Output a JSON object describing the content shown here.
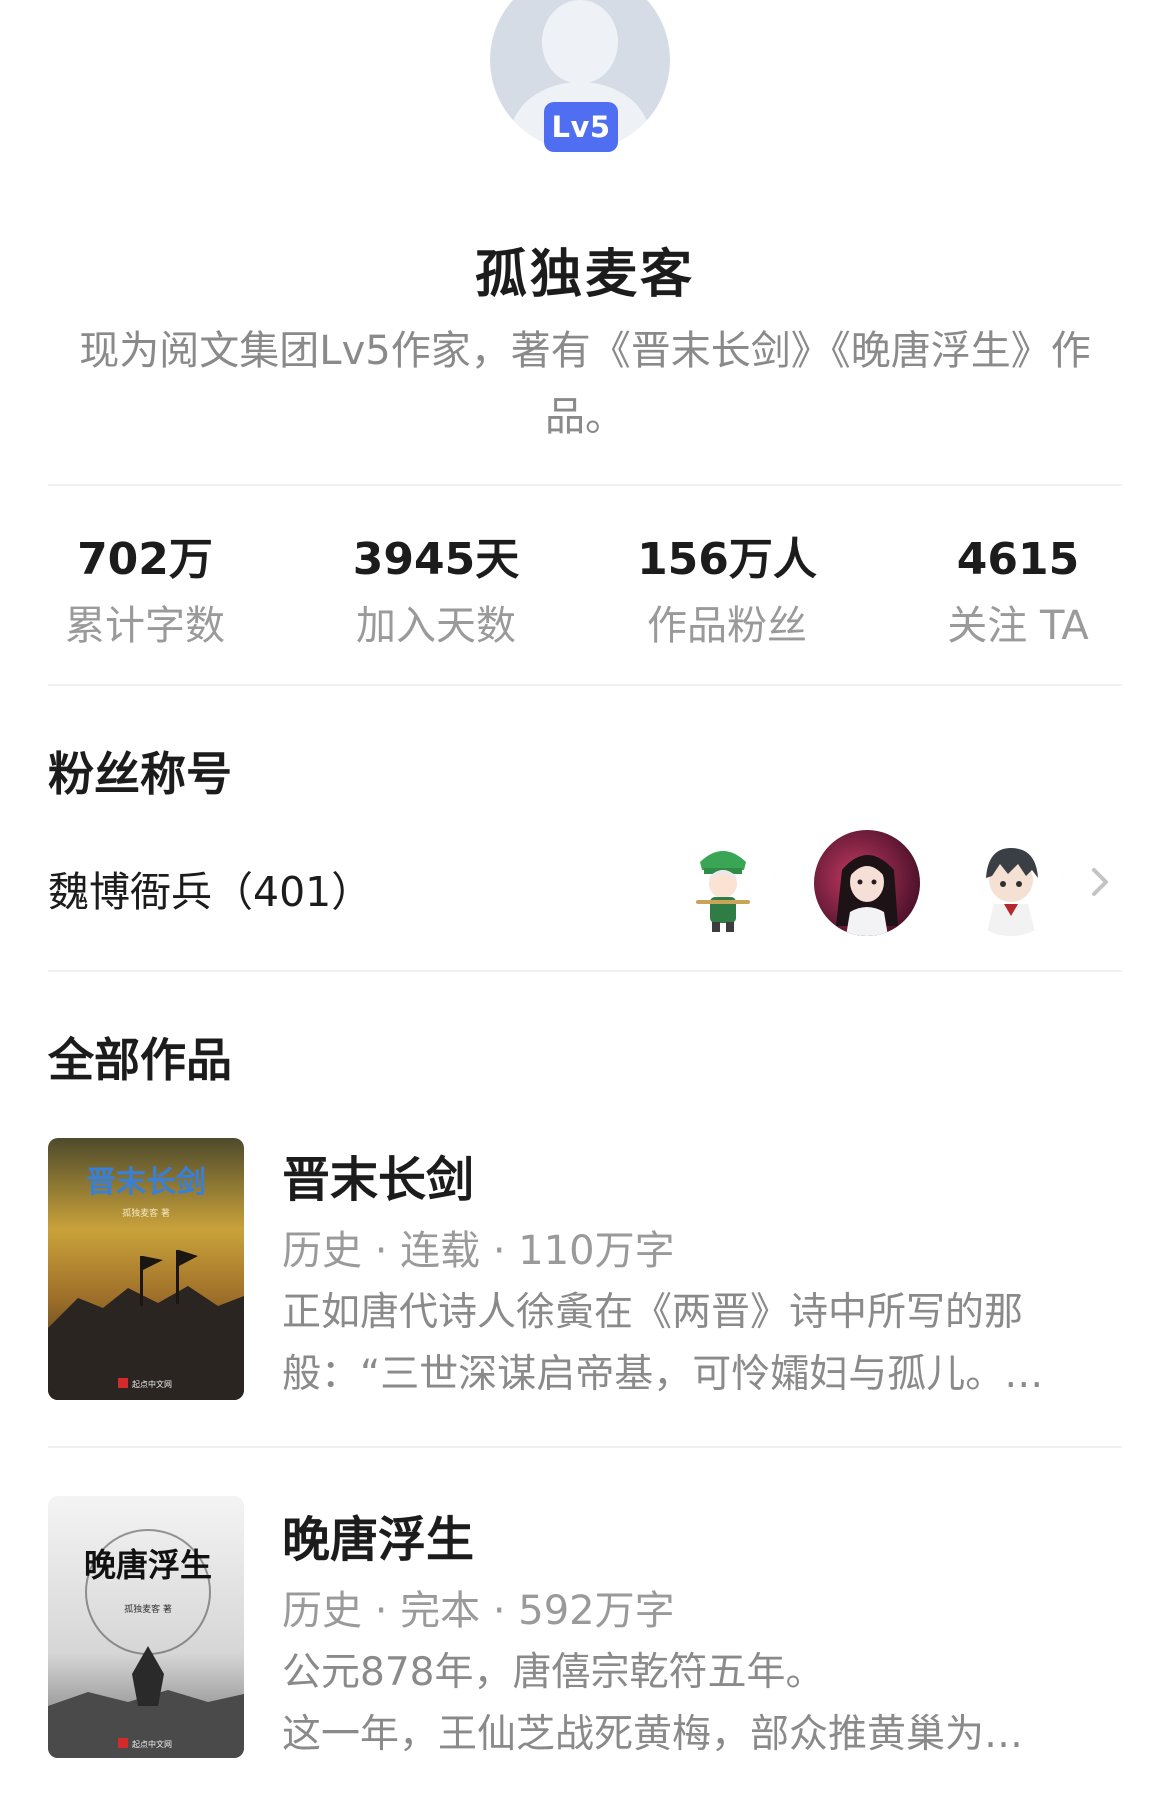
{
  "profile": {
    "level_badge": "Lv5",
    "name": "孤独麦客",
    "bio": "现为阅文集团Lv5作家，著有《晋末长剑》《晚唐浮生》作品。"
  },
  "stats": [
    {
      "value": "702万",
      "label": "累计字数"
    },
    {
      "value": "3945天",
      "label": "加入天数"
    },
    {
      "value": "156万人",
      "label": "作品粉丝"
    },
    {
      "value": "4615",
      "label": "关注 TA"
    }
  ],
  "fan_section": {
    "title": "粉丝称号",
    "fan_title": "魏博衙兵（401）"
  },
  "works_section": {
    "title": "全部作品",
    "books": [
      {
        "title": "晋末长剑",
        "meta": "历史 · 连载 · 110万字",
        "desc_line1": "正如唐代诗人徐夤在《两晋》诗中所写的那",
        "desc_line2": "般：“三世深谋启帝基，可怜孀妇与孤儿。…",
        "cover_title": "晋末长剑",
        "cover_author": "孤独麦客 著",
        "cover_publisher": "起点中文网"
      },
      {
        "title": "晚唐浮生",
        "meta": "历史 · 完本 · 592万字",
        "desc_line1": "公元878年，唐僖宗乾符五年。",
        "desc_line2": "这一年，王仙芝战死黄梅，部众推黄巢为…",
        "cover_title": "晚唐浮生",
        "cover_author": "孤独麦客 著",
        "cover_publisher": "起点中文网"
      }
    ]
  },
  "colors": {
    "badge": "#4f6ef2",
    "primary_text": "#1c1c1c",
    "secondary_text": "#9a9a9a",
    "divider": "#f0f0f0"
  },
  "icons": {
    "chevron": "chevron-right-icon",
    "avatar": "avatar-placeholder"
  }
}
